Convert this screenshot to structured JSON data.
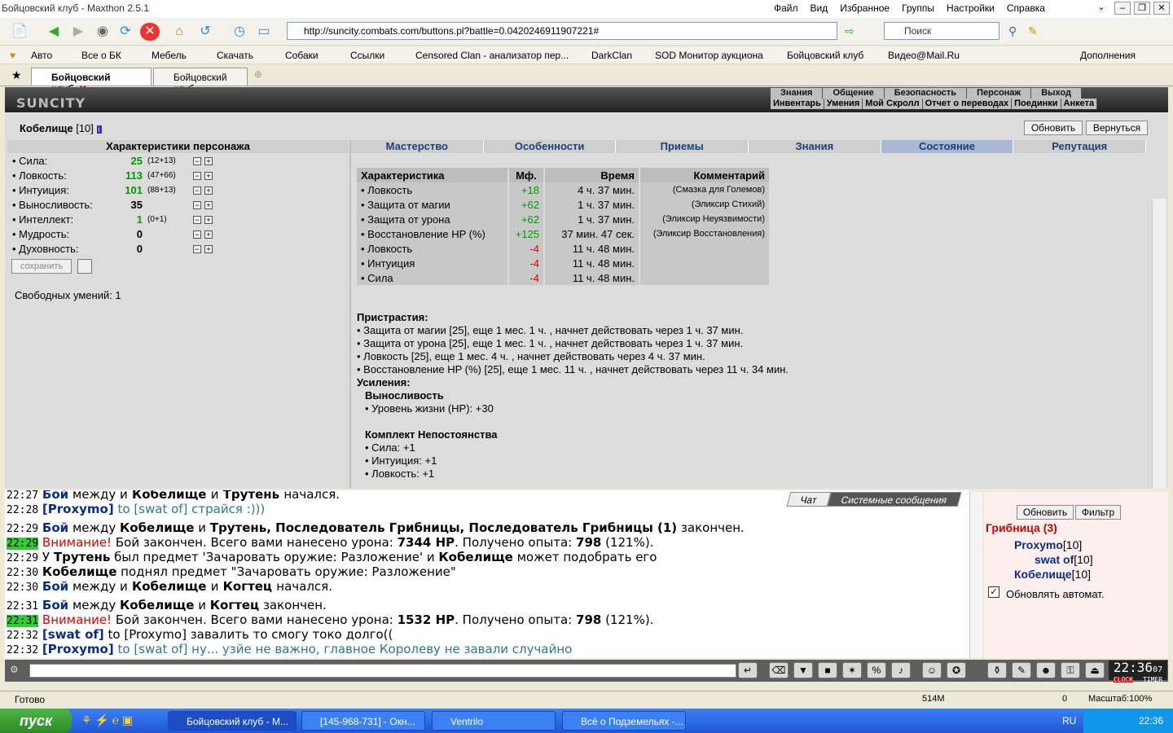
{
  "window": {
    "title": "Бойцовский клуб - Maxthon 2.5.1",
    "menu": [
      "Файл",
      "Вид",
      "Избранное",
      "Группы",
      "Настройки",
      "Справка"
    ]
  },
  "address": {
    "url": "http://suncity.combats.com/buttons.pl?battle=0.0420246911907221#",
    "search_placeholder": "Поиск"
  },
  "bookmarks": [
    "Авто",
    "Все о БК",
    "Мебель",
    "Скачать",
    "Собаки",
    "Ссылки",
    "Censored Clan - анализатор пер...",
    "DarkClan",
    "SOD Монитор аукциона",
    "Бойцовский клуб",
    "Видео@Mail.Ru",
    "Дополнения"
  ],
  "tabs": [
    "Бойцовский клуб",
    "Бойцовский клуб"
  ],
  "game": {
    "logo": "SUNCITY",
    "nav1": [
      "Знания",
      "Общение",
      "Безопасность",
      "Персонаж",
      "Выход"
    ],
    "nav2": [
      "Инвентарь",
      "Умения",
      "Мой Скролл",
      "Отчет о переводах",
      "Поединки",
      "Анкета"
    ]
  },
  "character": {
    "name": "Кобелище",
    "level": "[10]",
    "refresh": "Обновить",
    "back": "Вернуться",
    "stats_title": "Характеристики персонажа",
    "stats": [
      {
        "name": "• Сила:",
        "value": "25",
        "bonus": "(12+13)",
        "color": "green"
      },
      {
        "name": "• Ловкость:",
        "value": "113",
        "bonus": "(47+66)",
        "color": "green"
      },
      {
        "name": "• Интуиция:",
        "value": "101",
        "bonus": "(88+13)",
        "color": "green"
      },
      {
        "name": "• Выносливость:",
        "value": "35",
        "bonus": "",
        "color": "black"
      },
      {
        "name": "• Интеллект:",
        "value": "1",
        "bonus": "(0+1)",
        "color": "green"
      },
      {
        "name": "• Мудрость:",
        "value": "0",
        "bonus": "",
        "color": "black"
      },
      {
        "name": "• Духовность:",
        "value": "0",
        "bonus": "",
        "color": "black"
      }
    ],
    "save": "сохранить",
    "free_skills": "Свободных умений: 1"
  },
  "panel_tabs": [
    "Мастерство",
    "Особенности",
    "Приемы",
    "Знания",
    "Состояние",
    "Репутация"
  ],
  "effects": {
    "headers": [
      "Характеристика",
      "Мф.",
      "Время",
      "Комментарий"
    ],
    "rows": [
      [
        "• Ловкость",
        "+18",
        "4 ч. 37 мин.",
        "(Смазка для Големов)"
      ],
      [
        "• Защита от магии",
        "+62",
        "1 ч. 37 мин.",
        "(Эликсир Стихий)"
      ],
      [
        "• Защита от урона",
        "+62",
        "1 ч. 37 мин.",
        "(Эликсир Неуязвимости)"
      ],
      [
        "• Восстановление HP (%)",
        "+125",
        "37 мин. 47 сек.",
        "(Эликсир Восстановления)"
      ],
      [
        "• Ловкость",
        "-4",
        "11 ч. 48 мин.",
        ""
      ],
      [
        "• Интуиция",
        "-4",
        "11 ч. 48 мин.",
        ""
      ],
      [
        "• Сила",
        "-4",
        "11 ч. 48 мин.",
        ""
      ]
    ]
  },
  "addictions": {
    "title": "Пристрастия:",
    "items": [
      "• Защита от магии [25], еще 1 мес. 1 ч. , начнет действовать через 1 ч. 37 мин.",
      "• Защита от урона [25], еще 1 мес. 1 ч. , начнет действовать через 1 ч. 37 мин.",
      "• Ловкость [25], еще 1 мес. 4 ч. , начнет действовать через 4 ч. 37 мин.",
      "• Восстановление HP (%) [25], еще 1 мес. 11 ч. , начнет действовать через 11 ч. 34 мин."
    ],
    "boost_title": "Усиления:",
    "endurance": "Выносливость",
    "endurance_item": "• Уровень жизни (HP): +30",
    "set": "Комплект Непостоянства",
    "set_items": [
      "• Сила: +1",
      "• Интуиция: +1",
      "• Ловкость: +1"
    ]
  },
  "chat": {
    "tabs": [
      "Чат",
      "Системные сообщения"
    ],
    "l0": {
      "t": "22:27",
      "a": "Бой",
      "b": " между ",
      "c": "и",
      "d": " Кобелище ",
      "e": "и",
      "f": " Трутень ",
      "g": "начался."
    },
    "l1": {
      "t": "22:28",
      "a": "[Proxymo]",
      "b": " to [swat of] страйся :)))"
    },
    "l2": {
      "t": "22:29",
      "a": "Бой",
      "b": " между ",
      "c": "Кобелище",
      "d": " и ",
      "e": "Трутень, Последователь Грибницы, Последователь Грибницы (1)",
      "f": " закончен."
    },
    "l3": {
      "t": "22:29",
      "w": "Внимание!",
      "a": " Бой закончен. Всего вами нанесено урона: ",
      "b": "7344 HP",
      "c": ". Получено опыта: ",
      "d": "798",
      "e": " (121%)."
    },
    "l4": {
      "t": "22:29",
      "a": "У ",
      "b": "Трутень",
      "c": " был предмет 'Зачаровать оружие: Разложение' и ",
      "d": "Кобелище",
      "e": " может подобрать его"
    },
    "l5": {
      "t": "22:30",
      "a": "Кобелище",
      "b": " поднял предмет \"Зачаровать оружие: Разложение\""
    },
    "l6": {
      "t": "22:30",
      "a": "Бой",
      "b": " между ",
      "c": "и",
      "d": " Кобелище ",
      "e": "и",
      "f": " Когтец ",
      "g": "начался."
    },
    "l7": {
      "t": "22:31",
      "a": "Бой",
      "b": " между ",
      "c": "Кобелище",
      "d": " и ",
      "e": "Когтец",
      "f": " закончен."
    },
    "l8": {
      "t": "22:31",
      "w": "Внимание!",
      "a": " Бой закончен. Всего вами нанесено урона: ",
      "b": "1532 HP",
      "c": ". Получено опыта: ",
      "d": "798",
      "e": " (121%)."
    },
    "l9": {
      "t": "22:32",
      "a": "[swat of]",
      "b": " to [Proxymo] завалить то смогу токо долго(("
    },
    "l10": {
      "t": "22:32",
      "a": "[Proxymo]",
      "b": " to [swat of] ну... узйе не важно, главное Королеву не завали случайно"
    }
  },
  "room": {
    "refresh": "Обновить",
    "filter": "Фильтр",
    "title": "Грибница (3)",
    "users": [
      {
        "name": "Proxymo",
        "lvl": "[10]"
      },
      {
        "name": "swat of",
        "lvl": "[10]"
      },
      {
        "name": "Кобелище",
        "lvl": "[10]"
      }
    ],
    "auto": "Обновлять автомат."
  },
  "clock": {
    "time": "22:36",
    "sec": "07",
    "label": "CLOCK",
    "timer": "TIMER"
  },
  "status": {
    "text": "Готово",
    "mem": "514M",
    "zero": "0",
    "zoom": "Масштаб:100%"
  },
  "taskbar": {
    "start": "пуск",
    "tasks": [
      "Бойцовский клуб - M...",
      "[145-968-731] - Окн...",
      "Ventrilo",
      "Всё о Подземельях -..."
    ],
    "lang": "RU",
    "time": "22:36"
  },
  "colors": {
    "accent": "#1c3f7a",
    "chat_link": "#0a2d8c",
    "warn": "#dd0000"
  }
}
